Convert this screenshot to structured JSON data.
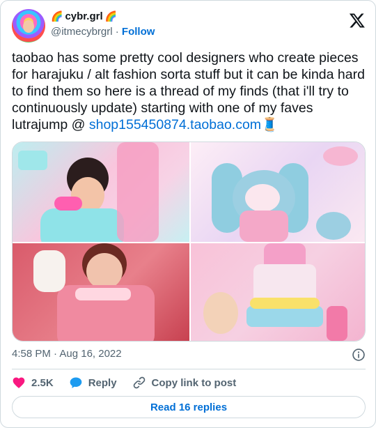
{
  "author": {
    "display_name": "cybr.grl",
    "name_emoji_left": "🌈",
    "name_emoji_right": "🌈",
    "handle": "@itmecybrgrl",
    "separator": "·",
    "follow_label": "Follow"
  },
  "tweet": {
    "text_before_link": "taobao has some pretty cool designers who create pieces for harajuku / alt fashion sorta stuff but it can be kinda hard to find them so here is a thread of my finds (that i'll try to continuously update) starting with one of my faves lutrajump @ ",
    "link_text": "shop155450874.taobao.com",
    "trailing_emoji": "🧵"
  },
  "media": {
    "count": 4
  },
  "meta": {
    "timestamp": "4:58 PM · Aug 16, 2022"
  },
  "actions": {
    "like_count": "2.5K",
    "reply_label": "Reply",
    "copy_link_label": "Copy link to post"
  },
  "read_replies_label": "Read 16 replies",
  "icons": {
    "logo": "x-logo-icon",
    "info": "info-icon",
    "like": "heart-icon",
    "reply": "reply-bubble-icon",
    "copy": "link-icon"
  },
  "colors": {
    "link": "#006fd6",
    "heart": "#f91880",
    "reply": "#1d9bf0",
    "muted": "#536471",
    "border": "#cfd9de"
  }
}
